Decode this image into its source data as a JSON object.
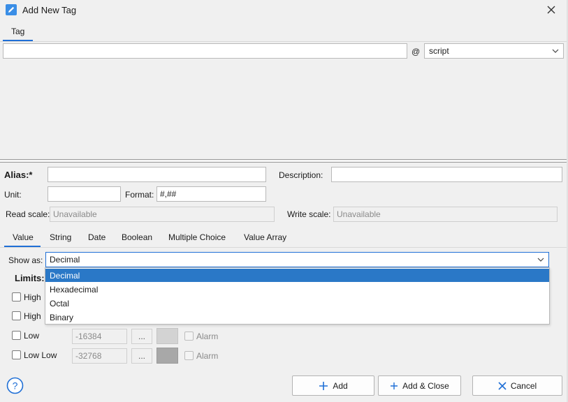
{
  "window": {
    "title": "Add New Tag"
  },
  "top_tabs": [
    {
      "label": "Tag"
    }
  ],
  "tag": {
    "name_value": "",
    "at_symbol": "@",
    "scope_value": "script"
  },
  "form": {
    "alias_label": "Alias:*",
    "alias_value": "",
    "description_label": "Description:",
    "description_value": "",
    "unit_label": "Unit:",
    "unit_value": "",
    "format_label": "Format:",
    "format_value": "#,##",
    "read_scale_label": "Read scale:",
    "read_scale_value": "Unavailable",
    "write_scale_label": "Write scale:",
    "write_scale_value": "Unavailable"
  },
  "type_tabs": [
    {
      "label": "Value"
    },
    {
      "label": "String"
    },
    {
      "label": "Date"
    },
    {
      "label": "Boolean"
    },
    {
      "label": "Multiple Choice"
    },
    {
      "label": "Value Array"
    }
  ],
  "show_as": {
    "label": "Show as:",
    "value": "Decimal",
    "options": [
      "Decimal",
      "Hexadecimal",
      "Octal",
      "Binary"
    ]
  },
  "limits": {
    "title": "Limits:",
    "rows": [
      {
        "label": "High",
        "value": ""
      },
      {
        "label": "High",
        "value": ""
      },
      {
        "label": "Low",
        "value": "-16384",
        "ellipsis": "...",
        "alarm": "Alarm",
        "swatch": "#d3d3d3"
      },
      {
        "label": "Low Low",
        "value": "-32768",
        "ellipsis": "...",
        "alarm": "Alarm",
        "swatch": "#a8a8a8"
      }
    ]
  },
  "footer": {
    "add": "Add",
    "add_close": "Add & Close",
    "cancel": "Cancel"
  },
  "colors": {
    "accent": "#1f6fd6",
    "selection": "#2a78c7"
  }
}
